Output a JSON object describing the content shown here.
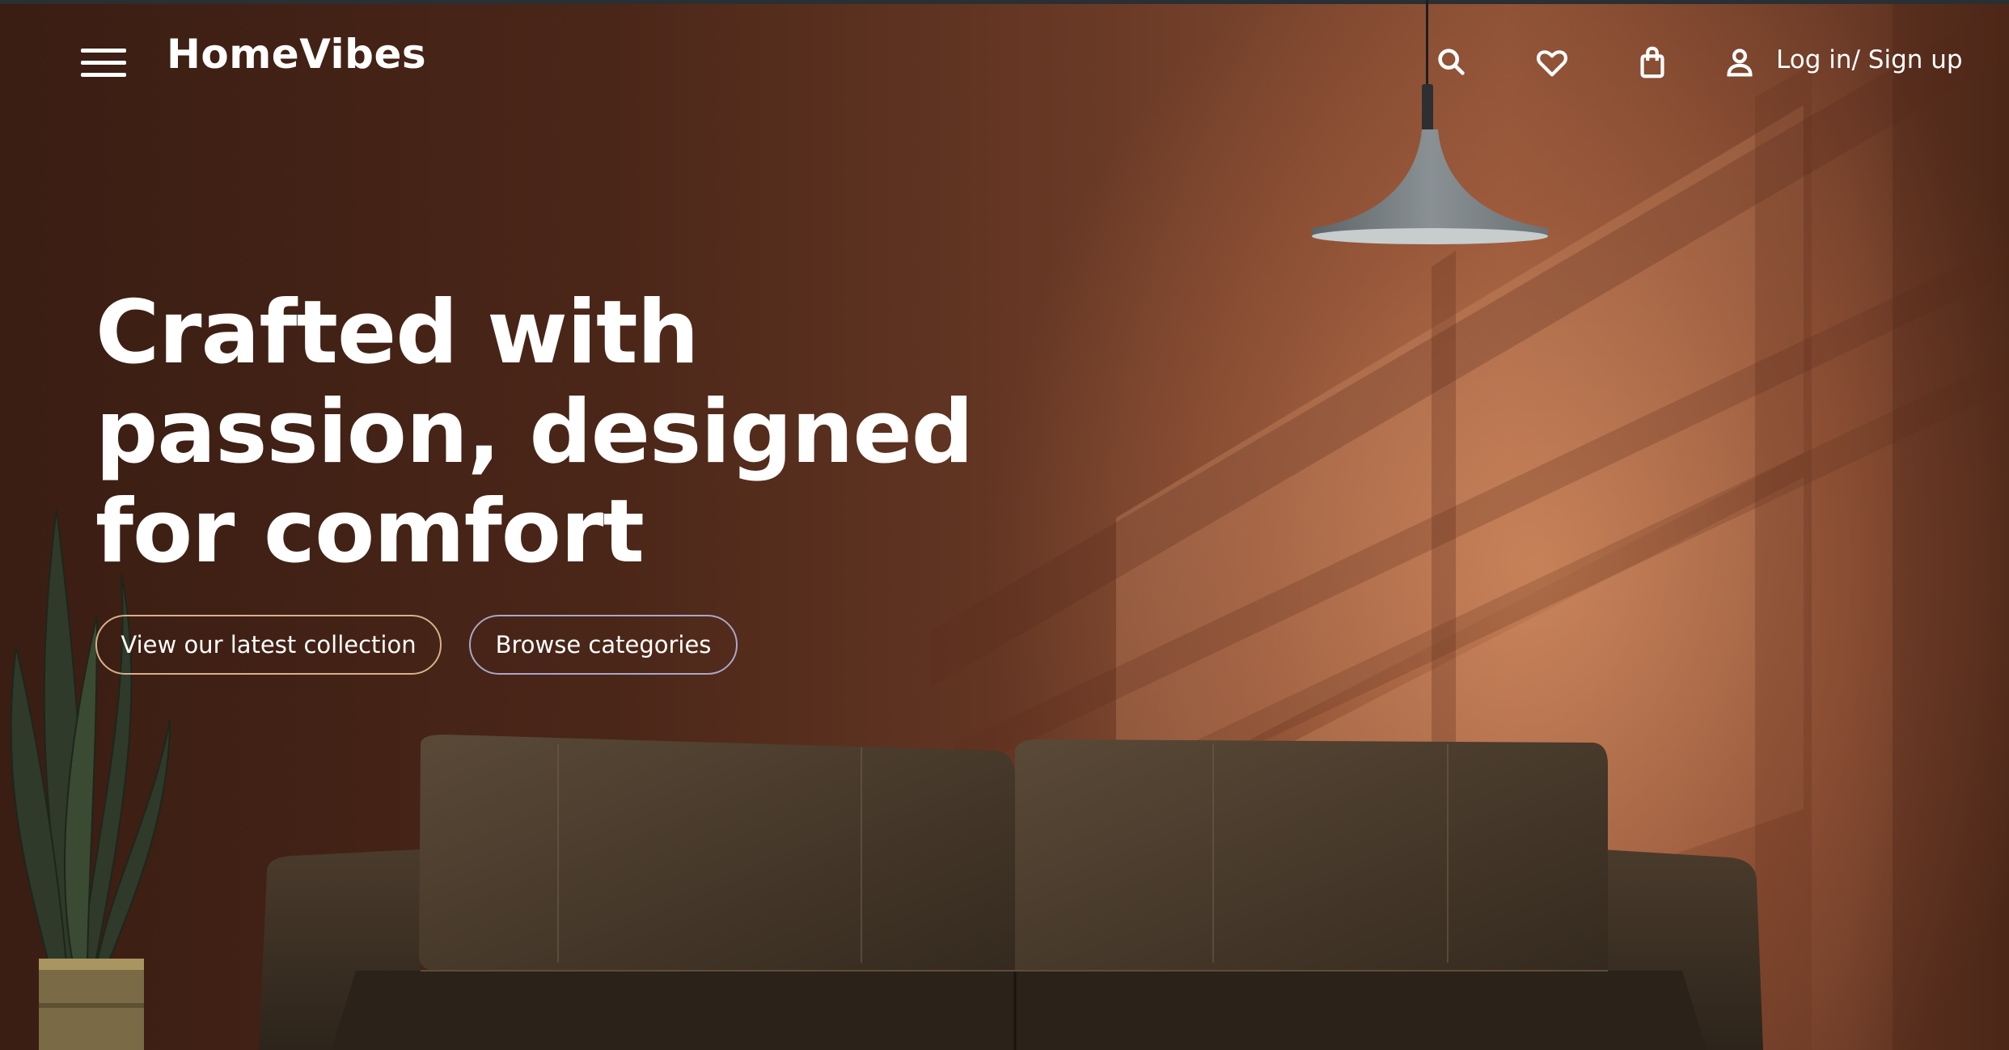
{
  "brand": {
    "name": "HomeVibes"
  },
  "nav": {
    "menu_icon": "hamburger-menu-icon",
    "icons": [
      "search-icon",
      "heart-icon",
      "shopping-bag-icon",
      "user-icon"
    ],
    "login_label": "Log in/ Sign up"
  },
  "hero": {
    "headline_lines": [
      "Crafted with",
      "passion, designed",
      "for comfort"
    ],
    "primary_button": "View our latest collection",
    "secondary_button": "Browse categories"
  },
  "colors": {
    "text": "#ffffff",
    "wall_dark": "#3a1d13",
    "wall_light": "#c98a63",
    "button_primary_border": "#d8b08a",
    "button_secondary_border": "#a9a7c8"
  }
}
